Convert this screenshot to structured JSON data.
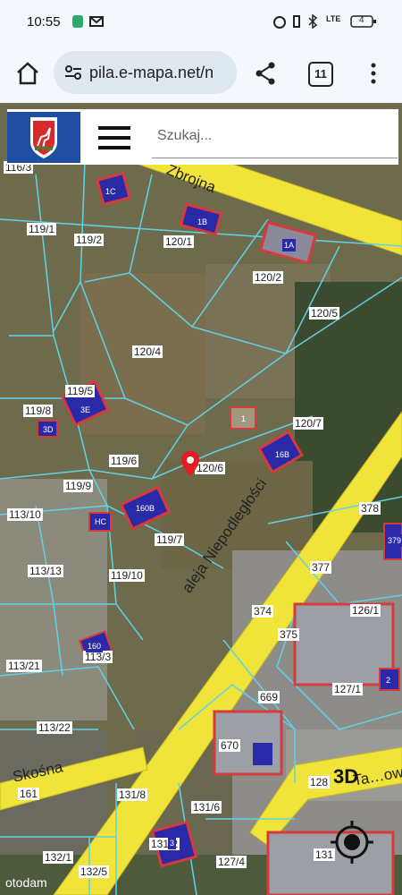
{
  "status_bar": {
    "time": "10:55",
    "battery": "4",
    "lte": "LTE"
  },
  "browser": {
    "url": "pila.e-mapa.net/n",
    "tab_count": "11"
  },
  "app": {
    "search_placeholder": "Szukaj..."
  },
  "map": {
    "streets": [
      "Zbrojna",
      "aleja Niepodległości",
      "Skośna",
      "Ta…owa"
    ],
    "parcels": [
      "119/1",
      "119/2",
      "120/1",
      "120/2",
      "120/5",
      "120/4",
      "119/5",
      "119/8",
      "119/6",
      "120/6",
      "120/7",
      "119/9",
      "113/10",
      "119/7",
      "378",
      "113/13",
      "119/10",
      "377",
      "374",
      "126/1",
      "375",
      "113/21",
      "113/3",
      "669",
      "127/1",
      "113/22",
      "670",
      "131/8",
      "131/6",
      "131/2",
      "127/4",
      "132/1",
      "132/5",
      "131",
      "161",
      "128",
      "116/3"
    ],
    "building_labels": [
      "1C",
      "1B",
      "1A",
      "3E",
      "3D",
      "1",
      "16B",
      "160B",
      "HC",
      "160",
      "379",
      "2",
      "3"
    ],
    "controls": {
      "three_d": "3D"
    },
    "marker": "selected-parcel-marker"
  },
  "watermark": "otodam",
  "colors": {
    "parcel_line": "#5fd3e6",
    "street_fill": "#f0e33a",
    "building_fill": "#2a2aa8",
    "building_outline": "#d63a3a",
    "marker": "#e31b23",
    "crest_bg": "#1f4ea3"
  }
}
